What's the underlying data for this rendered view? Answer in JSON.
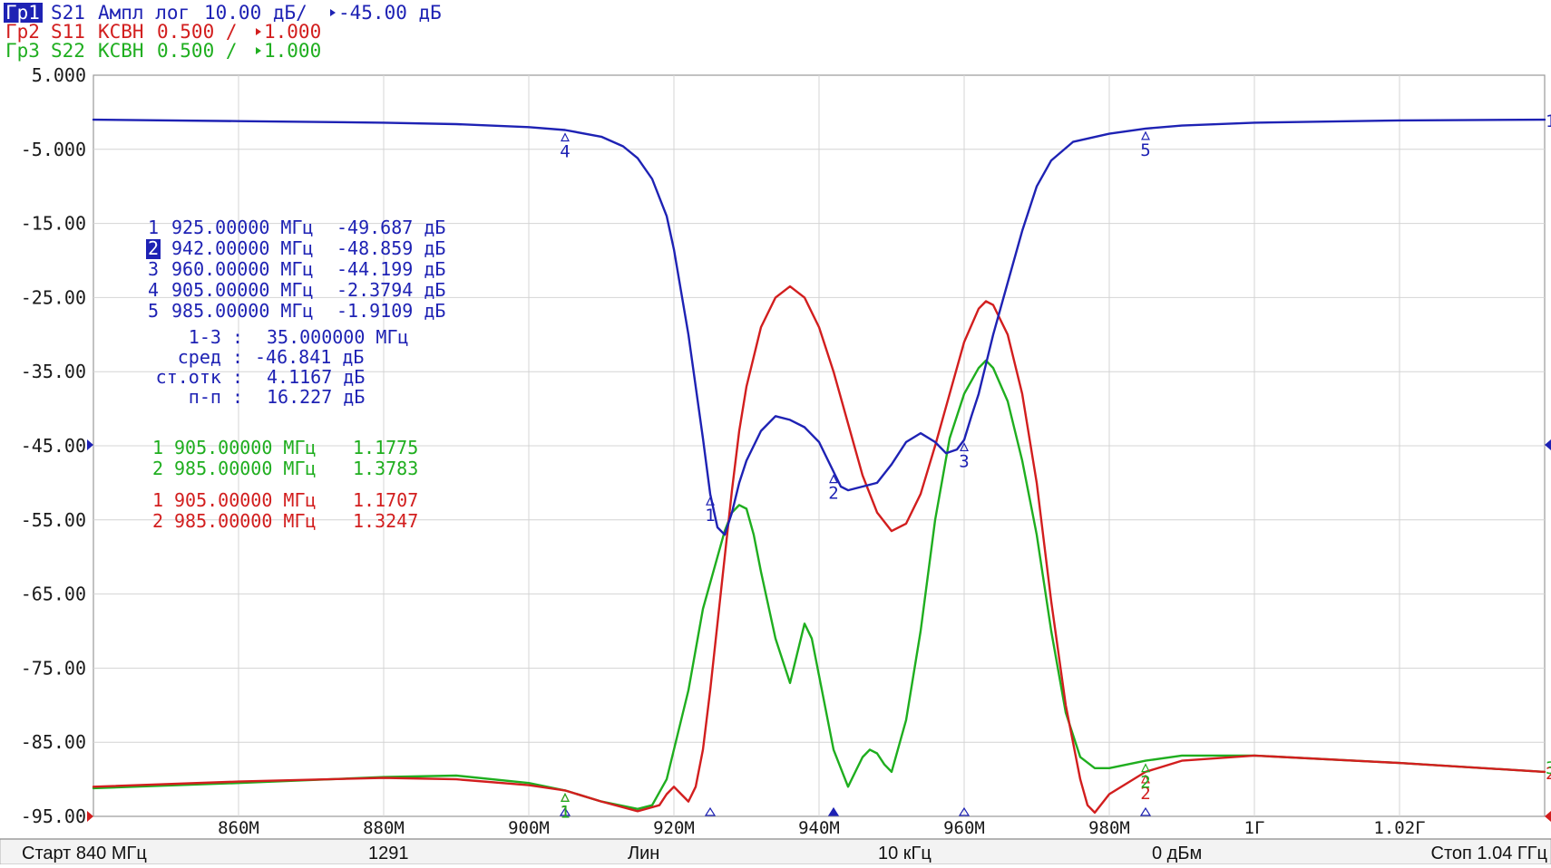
{
  "header": {
    "traces": [
      {
        "id": "Гр1",
        "param": "S21",
        "format": "Ампл лог",
        "scale": "10.00 дБ/",
        "ref": "-45.00 дБ",
        "color": "#1e22b4",
        "active": true
      },
      {
        "id": "Гр2",
        "param": "S11",
        "format": "КСВН",
        "scale": "0.500 /",
        "ref": "1.000",
        "color": "#d21e1e",
        "active": false
      },
      {
        "id": "Гр3",
        "param": "S22",
        "format": "КСВН",
        "scale": "0.500 /",
        "ref": "1.000",
        "color": "#1fae1f",
        "active": false
      }
    ]
  },
  "status": {
    "start": "Старт 840 МГц",
    "points": "1291",
    "sweep": "Лин",
    "ifbw": "10 кГц",
    "power": "0 дБм",
    "stop": "Стоп 1.04 ГГц"
  },
  "readout": {
    "blue_markers": [
      {
        "n": "1",
        "freq": "925.00000 МГц",
        "value": "-49.687 дБ",
        "active": false
      },
      {
        "n": "2",
        "freq": "942.00000 МГц",
        "value": "-48.859 дБ",
        "active": true
      },
      {
        "n": "3",
        "freq": "960.00000 МГц",
        "value": "-44.199 дБ",
        "active": false
      },
      {
        "n": "4",
        "freq": "905.00000 МГц",
        "value": "-2.3794 дБ",
        "active": false
      },
      {
        "n": "5",
        "freq": "985.00000 МГц",
        "value": "-1.9109 дБ",
        "active": false
      }
    ],
    "stats": [
      {
        "label": "1-3 :",
        "value": "35.000000 МГц"
      },
      {
        "label": "сред :",
        "value": "-46.841 дБ"
      },
      {
        "label": "ст.отк :",
        "value": "4.1167 дБ"
      },
      {
        "label": "п-п :",
        "value": "16.227 дБ"
      }
    ],
    "green_markers": [
      {
        "n": "1",
        "freq": "905.00000 МГц",
        "value": "1.1775"
      },
      {
        "n": "2",
        "freq": "985.00000 МГц",
        "value": "1.3783"
      }
    ],
    "red_markers": [
      {
        "n": "1",
        "freq": "905.00000 МГц",
        "value": "1.1707"
      },
      {
        "n": "2",
        "freq": "985.00000 МГц",
        "value": "1.3247"
      }
    ]
  },
  "chart_data": {
    "type": "line",
    "xlabel": "",
    "ylabel": "",
    "xlim": [
      840,
      1040
    ],
    "ylim": [
      -95,
      5
    ],
    "x_ticks": [
      860,
      880,
      900,
      920,
      940,
      960,
      980,
      1000,
      1020
    ],
    "x_tick_labels": [
      "860M",
      "880M",
      "900M",
      "920M",
      "940M",
      "960M",
      "980M",
      "1Г",
      "1.02Г"
    ],
    "y_ticks": [
      5,
      -5,
      -15,
      -25,
      -35,
      -45,
      -55,
      -65,
      -75,
      -85,
      -95
    ],
    "y_tick_labels": [
      "5.000",
      "-5.000",
      "-15.00",
      "-25.00",
      "-35.00",
      "-45.00",
      "-55.00",
      "-65.00",
      "-75.00",
      "-85.00",
      "-95.00"
    ],
    "grid": true,
    "series": [
      {
        "color": "#1e22b4",
        "x": [
          840,
          860,
          880,
          890,
          900,
          905,
          910,
          913,
          915,
          917,
          919,
          920,
          922,
          924,
          925,
          926,
          927,
          928,
          929,
          930,
          932,
          934,
          936,
          938,
          940,
          942,
          943,
          944,
          946,
          948,
          950,
          952,
          954,
          956,
          957.5,
          959,
          960,
          961,
          962,
          963,
          964,
          966,
          968,
          970,
          972,
          975,
          980,
          985,
          990,
          1000,
          1020,
          1040
        ],
        "values": [
          -1.0,
          -1.2,
          -1.4,
          -1.6,
          -2.0,
          -2.4,
          -3.3,
          -4.6,
          -6.2,
          -9.0,
          -14.0,
          -18.5,
          -30.0,
          -44.0,
          -51.5,
          -56.0,
          -57.0,
          -54.0,
          -50.0,
          -47.0,
          -43.0,
          -41.0,
          -41.5,
          -42.5,
          -44.5,
          -48.5,
          -50.5,
          -51.0,
          -50.5,
          -50.0,
          -47.5,
          -44.5,
          -43.3,
          -44.5,
          -46.0,
          -45.5,
          -44.2,
          -41.0,
          -38.0,
          -34.0,
          -30.0,
          -23.0,
          -16.0,
          -10.0,
          -6.5,
          -4.0,
          -2.9,
          -2.2,
          -1.8,
          -1.4,
          -1.1,
          -1.0
        ]
      },
      {
        "color": "#d21e1e",
        "x": [
          840,
          860,
          880,
          890,
          900,
          905,
          910,
          915,
          918,
          919,
          920,
          921,
          922,
          923,
          924,
          925,
          926,
          927,
          928,
          929,
          930,
          932,
          934,
          936,
          938,
          940,
          942,
          944,
          946,
          948,
          950,
          952,
          954,
          956,
          958,
          960,
          962,
          963,
          964,
          966,
          968,
          970,
          972,
          974,
          976,
          977,
          978,
          980,
          985,
          990,
          1000,
          1020,
          1040
        ],
        "values": [
          -91.0,
          -90.3,
          -89.8,
          -90.0,
          -90.8,
          -91.5,
          -93.0,
          -94.3,
          -93.5,
          -92.0,
          -91.0,
          -92.0,
          -93.0,
          -91.0,
          -86.0,
          -78.0,
          -69.0,
          -60.0,
          -51.0,
          -43.0,
          -37.0,
          -29.0,
          -25.0,
          -23.5,
          -25.0,
          -29.0,
          -35.0,
          -42.0,
          -49.0,
          -54.0,
          -56.5,
          -55.5,
          -51.5,
          -45.0,
          -38.0,
          -31.0,
          -26.5,
          -25.5,
          -26.0,
          -30.0,
          -38.0,
          -50.0,
          -66.0,
          -80.0,
          -90.0,
          -93.5,
          -94.5,
          -92.0,
          -89.0,
          -87.5,
          -86.8,
          -87.8,
          -89.0
        ]
      },
      {
        "color": "#1fae1f",
        "x": [
          840,
          860,
          880,
          890,
          900,
          905,
          910,
          915,
          917,
          919,
          920,
          922,
          924,
          926,
          927,
          928,
          929,
          930,
          931,
          932,
          934,
          936,
          937,
          938,
          939,
          940,
          942,
          944,
          945,
          946,
          947,
          948,
          949,
          950,
          952,
          954,
          956,
          958,
          960,
          962,
          963,
          964,
          966,
          968,
          970,
          972,
          974,
          976,
          978,
          980,
          985,
          990,
          1000,
          1020,
          1040
        ],
        "values": [
          -91.2,
          -90.5,
          -89.7,
          -89.5,
          -90.5,
          -91.5,
          -93.0,
          -94.0,
          -93.5,
          -90.0,
          -86.0,
          -78.0,
          -67.0,
          -60.0,
          -56.5,
          -54.0,
          -53.0,
          -53.5,
          -57.0,
          -62.0,
          -71.0,
          -77.0,
          -73.0,
          -69.0,
          -71.0,
          -76.0,
          -86.0,
          -91.0,
          -89.0,
          -87.0,
          -86.0,
          -86.5,
          -88.0,
          -89.0,
          -82.0,
          -70.0,
          -55.0,
          -44.0,
          -38.0,
          -34.5,
          -33.5,
          -34.5,
          -39.0,
          -47.0,
          -57.0,
          -70.0,
          -81.0,
          -87.0,
          -88.5,
          -88.5,
          -87.5,
          -86.8,
          -86.8,
          -87.8,
          -89.0
        ]
      }
    ]
  },
  "trace_markers": [
    {
      "trace": 0,
      "n": "1",
      "x": 925
    },
    {
      "trace": 0,
      "n": "2",
      "x": 942
    },
    {
      "trace": 0,
      "n": "3",
      "x": 960
    },
    {
      "trace": 0,
      "n": "4",
      "x": 905
    },
    {
      "trace": 0,
      "n": "5",
      "x": 985
    },
    {
      "trace": 1,
      "n": "1",
      "x": 905
    },
    {
      "trace": 1,
      "n": "2",
      "x": 985
    },
    {
      "trace": 2,
      "n": "1",
      "x": 905
    },
    {
      "trace": 2,
      "n": "2",
      "x": 985
    }
  ]
}
